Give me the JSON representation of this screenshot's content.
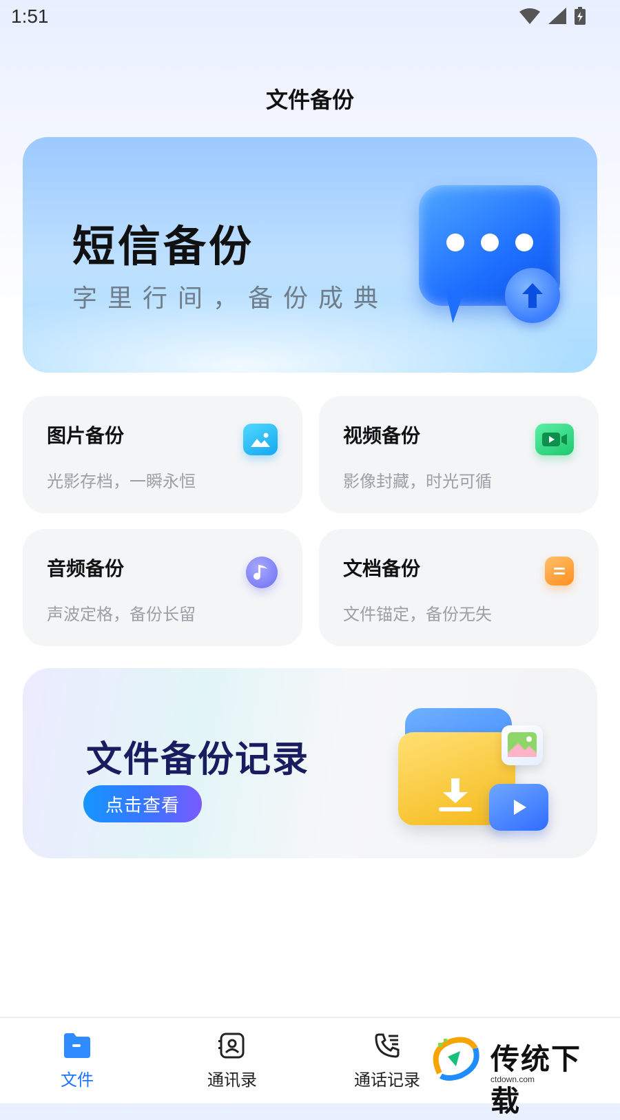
{
  "status": {
    "time": "1:51"
  },
  "page": {
    "title": "文件备份"
  },
  "sms_banner": {
    "title": "短信备份",
    "subtitle": "字里行间，备份成典"
  },
  "cards": [
    {
      "title": "图片备份",
      "subtitle": "光影存档，一瞬永恒",
      "icon": "image-icon",
      "color": "#20b7f5"
    },
    {
      "title": "视频备份",
      "subtitle": "影像封藏，时光可循",
      "icon": "video-camera-icon",
      "color": "#22d07a"
    },
    {
      "title": "音频备份",
      "subtitle": "声波定格，备份长留",
      "icon": "music-note-icon",
      "color": "#7a7dff"
    },
    {
      "title": "文档备份",
      "subtitle": "文件锚定，备份无失",
      "icon": "document-icon",
      "color": "#ff9a2e"
    }
  ],
  "record_banner": {
    "title": "文件备份记录",
    "button": "点击查看"
  },
  "bottom_nav": [
    {
      "label": "文件",
      "icon": "folder-icon",
      "active": true
    },
    {
      "label": "通讯录",
      "icon": "contacts-icon",
      "active": false
    },
    {
      "label": "通话记录",
      "icon": "call-log-icon",
      "active": false
    }
  ],
  "watermark": {
    "text": "传统下载",
    "url": "ctdown.com"
  },
  "colors": {
    "accent": "#1a74ff",
    "card_bg": "#f4f5f7"
  }
}
